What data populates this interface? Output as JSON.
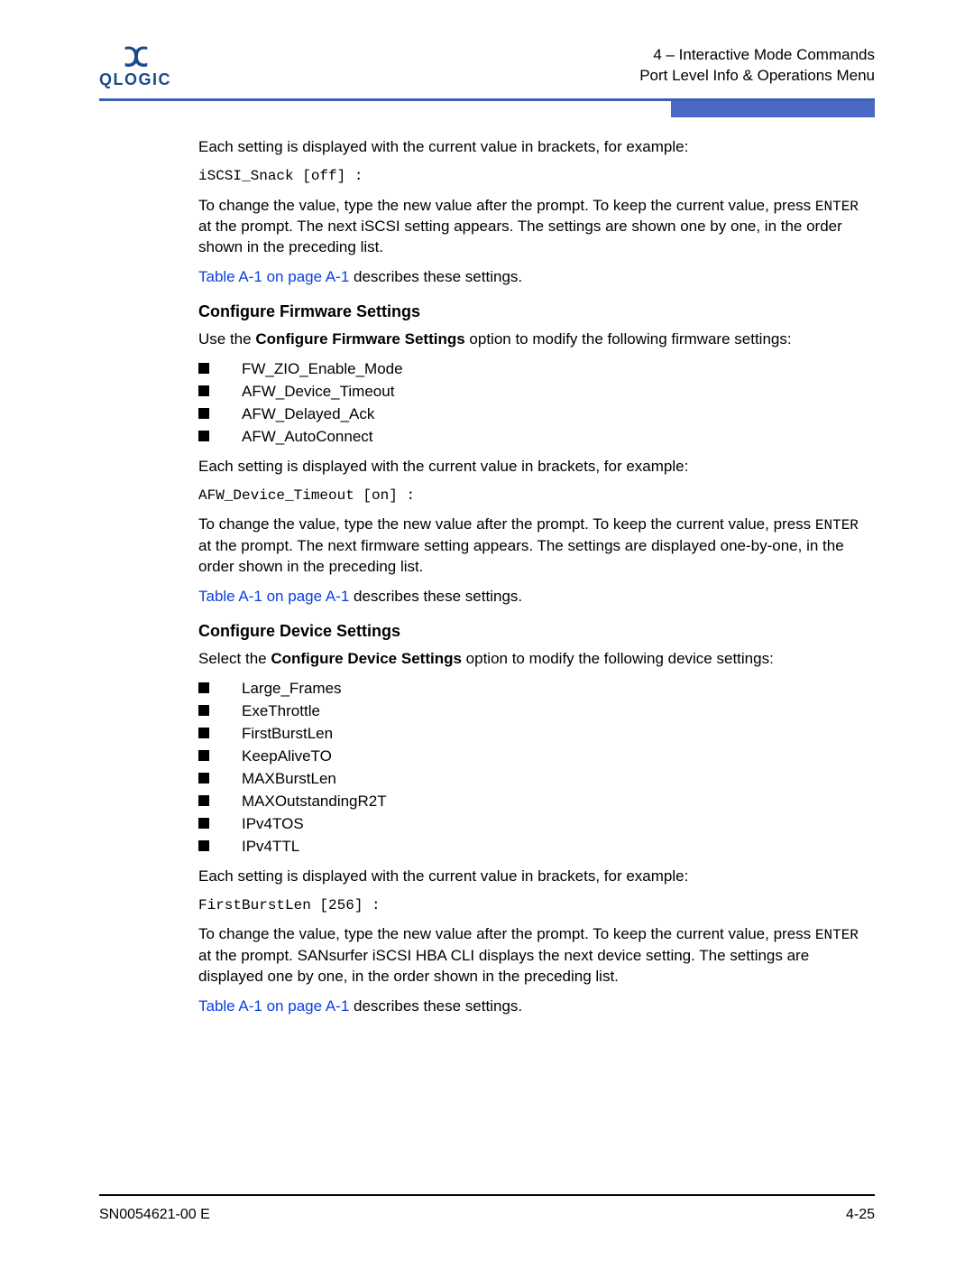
{
  "header": {
    "logo_text": "QLOGIC",
    "line1": "4 – Interactive Mode Commands",
    "line2": "Port Level Info & Operations Menu"
  },
  "body": {
    "intro1": "Each setting is displayed with the current value in brackets, for example:",
    "code1": "iSCSI_Snack [off] :",
    "para2a": "To change the value, type the new value after the prompt. To keep the current value, press ",
    "enter": "ENTER",
    "para2b": " at the prompt. The next iSCSI setting appears. The settings are shown one by one, in the order shown in the preceding list.",
    "link1": "Table A-1 on page A-1",
    "link1_after": " describes these settings.",
    "heading1": "Configure Firmware Settings",
    "fw_para_a": "Use the ",
    "fw_para_b": "Configure Firmware Settings",
    "fw_para_c": " option to modify the following firmware settings:",
    "fw_list": [
      "FW_ZIO_Enable_Mode",
      "AFW_Device_Timeout",
      "AFW_Delayed_Ack",
      "AFW_AutoConnect"
    ],
    "fw_intro": "Each setting is displayed with the current value in brackets, for example:",
    "code2": "AFW_Device_Timeout [on] :",
    "fw_change_a": "To change the value, type the new value after the prompt. To keep the current value, press ",
    "fw_change_b": " at the prompt. The next firmware setting appears. The settings are displayed one-by-one, in the order shown in the preceding list.",
    "link2": "Table A-1 on page A-1",
    "link2_after": " describes these settings.",
    "heading2": "Configure Device Settings",
    "dev_para_a": "Select the ",
    "dev_para_b": "Configure Device Settings",
    "dev_para_c": " option to modify the following device settings:",
    "dev_list": [
      "Large_Frames",
      "ExeThrottle",
      "FirstBurstLen",
      "KeepAliveTO",
      "MAXBurstLen",
      "MAXOutstandingR2T",
      "IPv4TOS",
      "IPv4TTL"
    ],
    "dev_intro": "Each setting is displayed with the current value in brackets, for example:",
    "code3": "FirstBurstLen [256] :",
    "dev_change_a": "To change the value, type the new value after the prompt. To keep the current value, press ",
    "dev_change_b": " at the prompt. SANsurfer iSCSI HBA CLI displays the next device setting. The settings are displayed one by one, in the order shown in the preceding list.",
    "link3": "Table A-1 on page A-1",
    "link3_after": " describes these settings."
  },
  "footer": {
    "left": "SN0054621-00 E",
    "right": "4-25"
  }
}
